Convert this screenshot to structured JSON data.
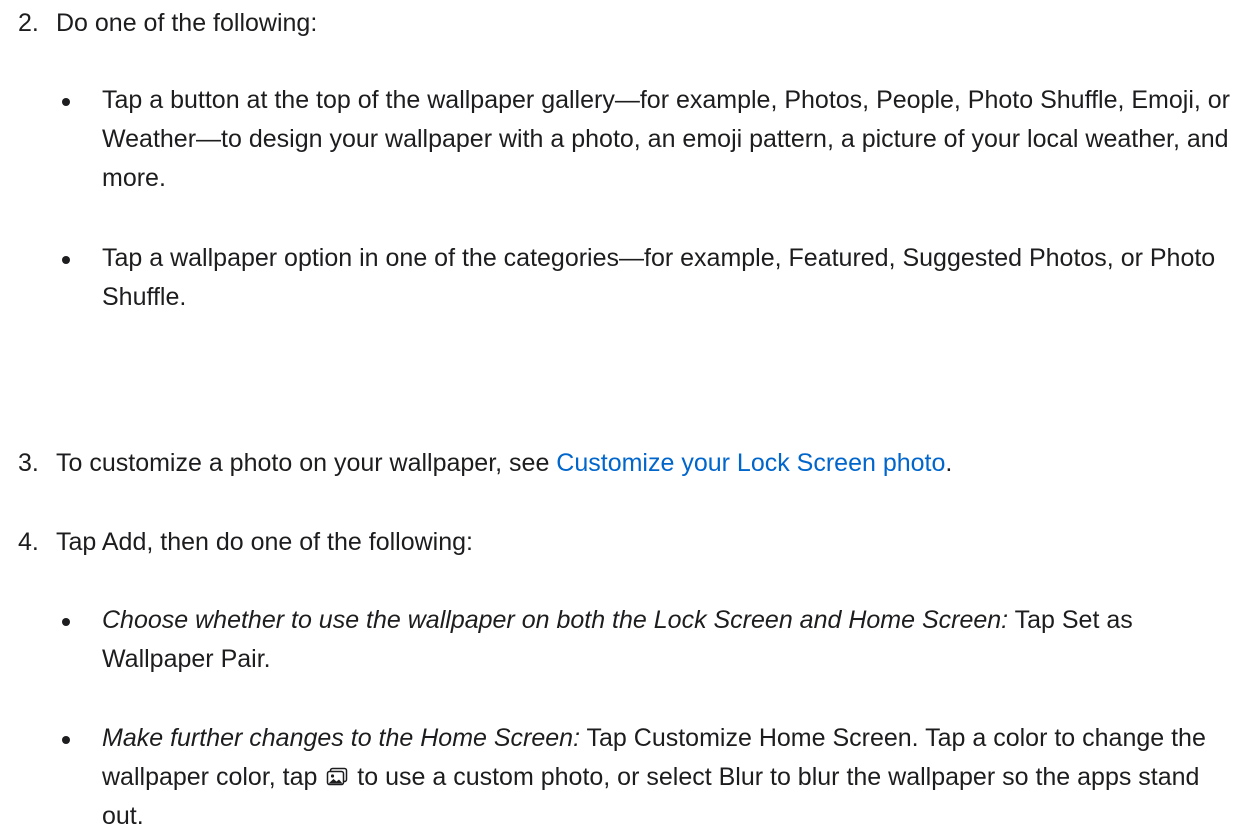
{
  "steps": [
    {
      "number": "2.",
      "text": "Do one of the following:",
      "bullets": [
        {
          "text": "Tap a button at the top of the wallpaper gallery—for example, Photos, People, Photo Shuffle, Emoji, or Weather—to design your wallpaper with a photo, an emoji pattern, a picture of your local weather, and more."
        },
        {
          "text": "Tap a wallpaper option in one of the categories—for example, Featured, Suggested Photos, or Photo Shuffle."
        }
      ]
    },
    {
      "number": "3.",
      "text_before": "To customize a photo on your wallpaper, see ",
      "link": "Customize your Lock Screen photo",
      "text_after": "."
    },
    {
      "number": "4.",
      "text": "Tap Add, then do one of the following:",
      "bullets": [
        {
          "italic": "Choose whether to use the wallpaper on both the Lock Screen and Home Screen:",
          "text": " Tap Set as Wallpaper Pair."
        },
        {
          "italic": "Make further changes to the Home Screen:",
          "text_before_icon": " Tap Customize Home Screen. Tap a color to change the wallpaper color, tap ",
          "icon": "photo-icon",
          "text_after_icon": " to use a custom photo, or select Blur to blur the wallpaper so the apps stand out."
        }
      ]
    }
  ]
}
